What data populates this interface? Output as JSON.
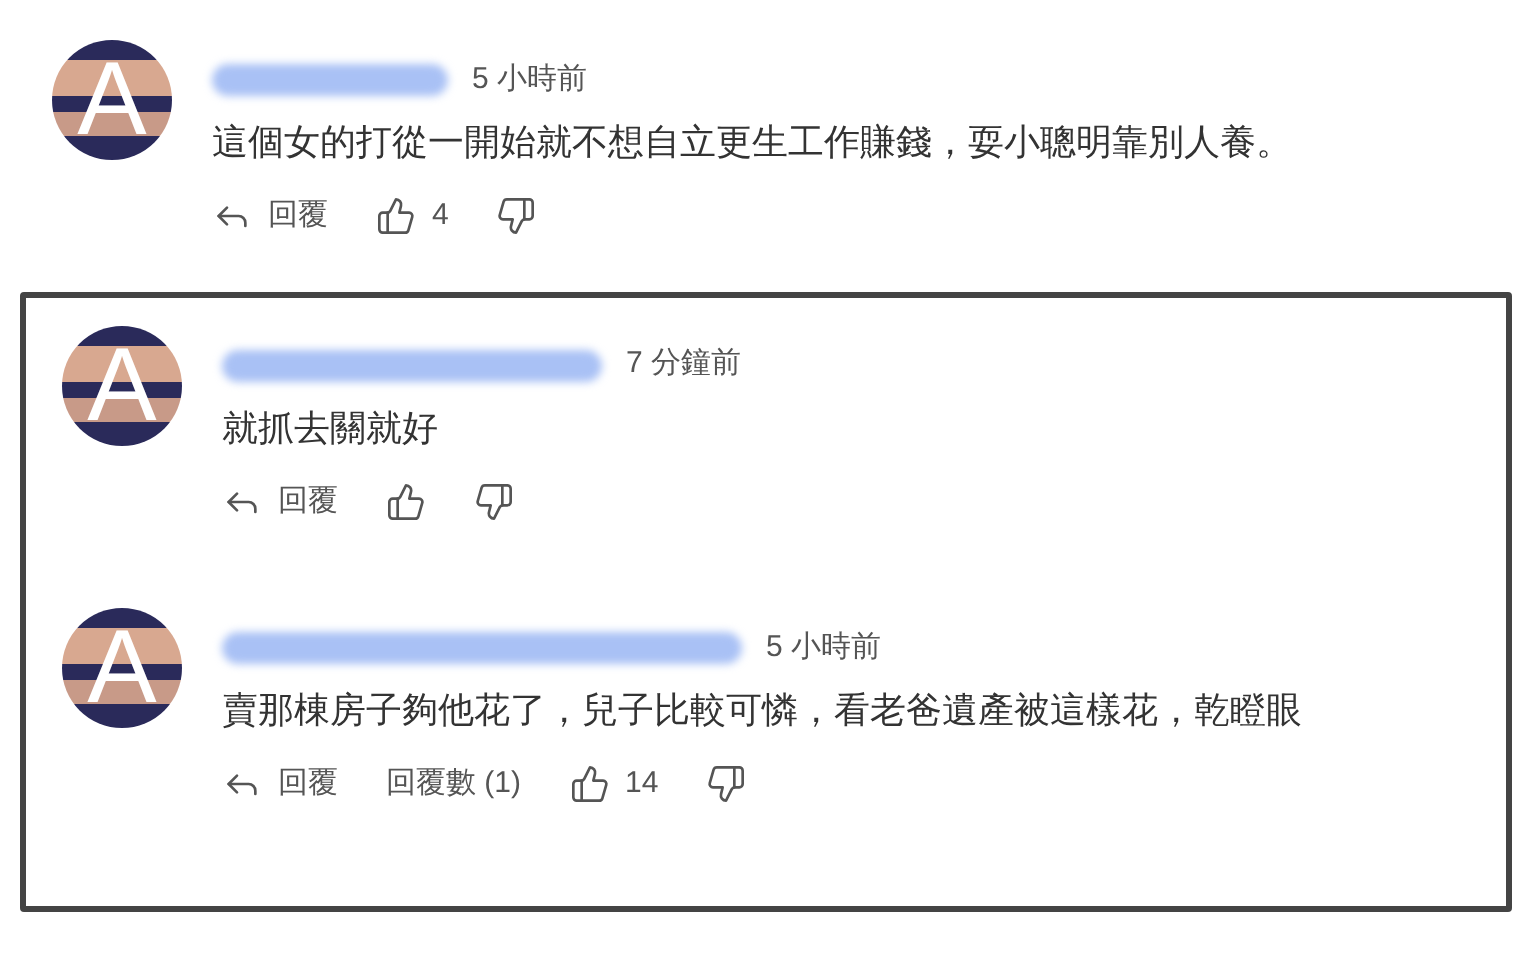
{
  "comments": [
    {
      "avatar_letter": "A",
      "time": "5 小時前",
      "text": "這個女的打從一開始就不想自立更生工作賺錢，耍小聰明靠別人養。",
      "reply_label": "回覆",
      "likes": "4"
    }
  ],
  "highlighted_thread": [
    {
      "avatar_letter": "A",
      "time": "7 分鐘前",
      "text": "就抓去關就好",
      "reply_label": "回覆"
    },
    {
      "avatar_letter": "A",
      "time": "5 小時前",
      "text": "賣那棟房子夠他花了，兒子比較可憐，看老爸遺產被這樣花，乾瞪眼",
      "reply_label": "回覆",
      "replies_count": "回覆數 (1)",
      "likes": "14"
    }
  ]
}
